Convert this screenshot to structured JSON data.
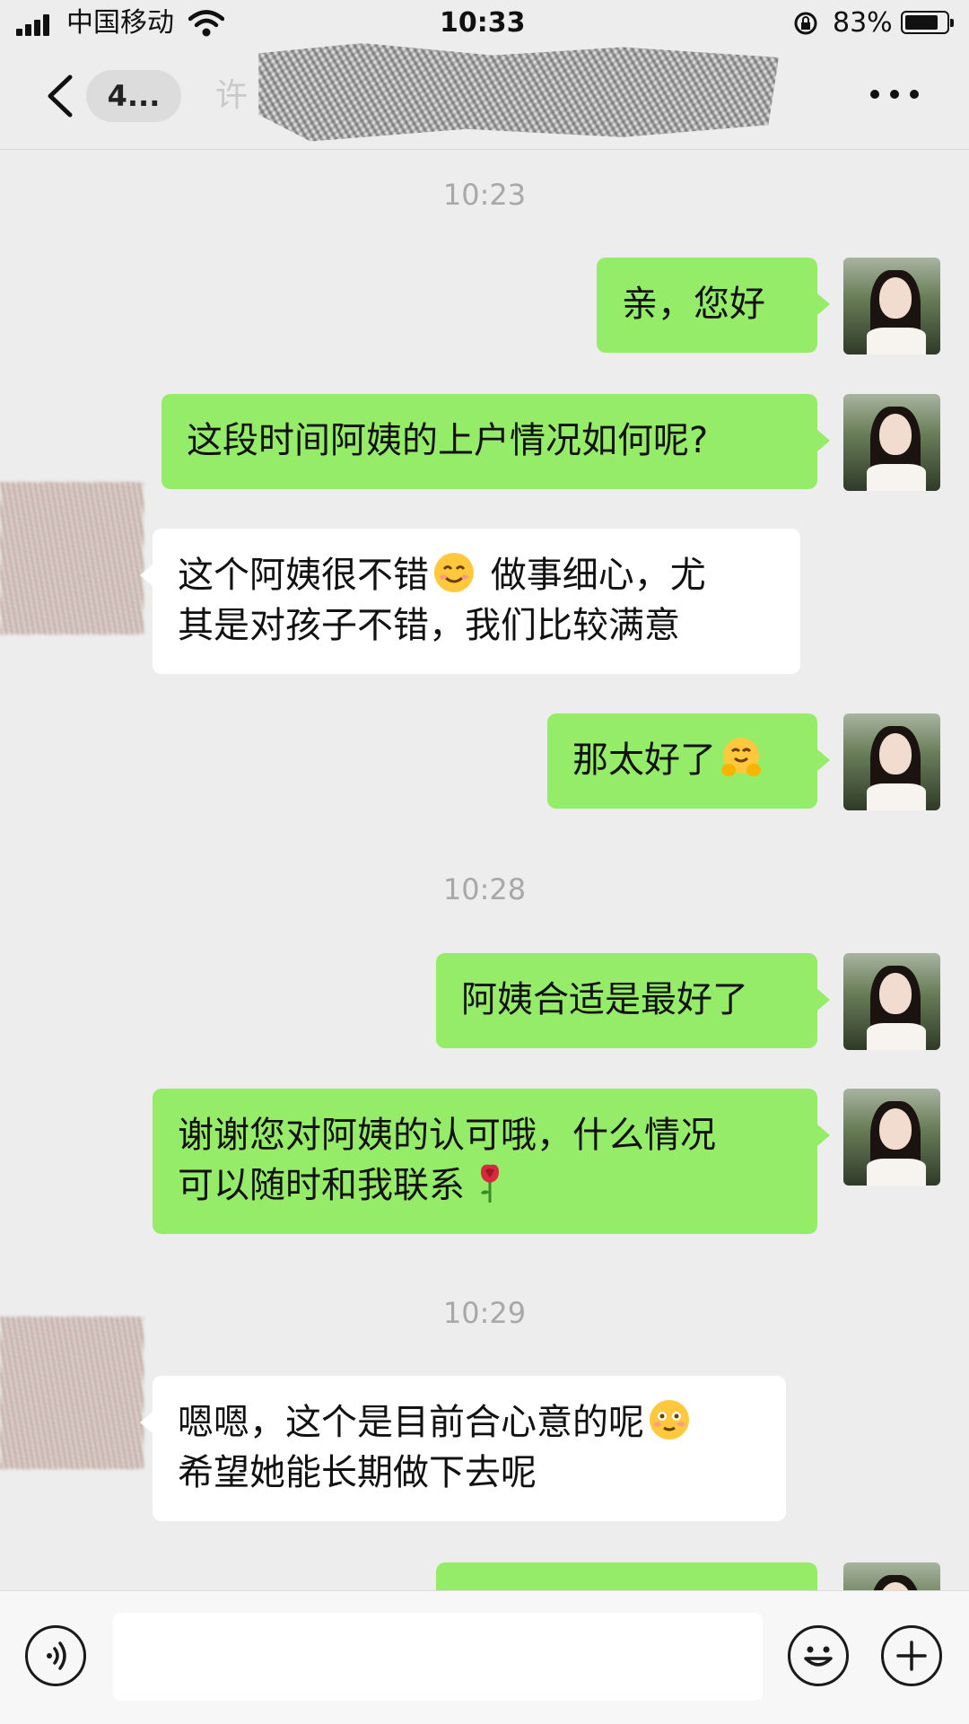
{
  "status_bar": {
    "carrier": "中国移动",
    "time": "10:33",
    "battery_percent": "83%",
    "battery_level": 0.83
  },
  "nav": {
    "unread_count": "4...",
    "title_visible": "许",
    "back_icon": "chevron-left-icon",
    "more_icon": "more-dots-icon"
  },
  "messages": [
    {
      "type": "time",
      "text": "10:23"
    },
    {
      "type": "msg",
      "from": "me",
      "text": "亲，您好"
    },
    {
      "type": "msg",
      "from": "me",
      "text": "这段时间阿姨的上户情况如何呢?"
    },
    {
      "type": "msg",
      "from": "other",
      "line1": "这个阿姨很不错",
      "emoji1": "smiling-face-emoji",
      "line1b": " 做事细心，尤",
      "line2": "其是对孩子不错，我们比较满意"
    },
    {
      "type": "msg",
      "from": "me",
      "text": "那太好了",
      "emoji": "hugging-face-emoji"
    },
    {
      "type": "time",
      "text": "10:28"
    },
    {
      "type": "msg",
      "from": "me",
      "text": "阿姨合适是最好了"
    },
    {
      "type": "msg",
      "from": "me",
      "line1": "谢谢您对阿姨的认可哦，什么情况",
      "line2": "可以随时和我联系",
      "emoji": "rose-emoji"
    },
    {
      "type": "time",
      "text": "10:29"
    },
    {
      "type": "msg",
      "from": "other",
      "line1": "嗯嗯，这个是目前合心意的呢",
      "emoji": "blushing-face-emoji",
      "line2": "希望她能长期做下去呢"
    }
  ],
  "input_bar": {
    "voice_icon": "voice-icon",
    "emoji_icon": "emoji-icon",
    "plus_icon": "plus-icon",
    "placeholder": ""
  },
  "colors": {
    "background": "#ededed",
    "my_bubble": "#95ec69",
    "other_bubble": "#ffffff",
    "timestamp": "#a8a8a8"
  }
}
